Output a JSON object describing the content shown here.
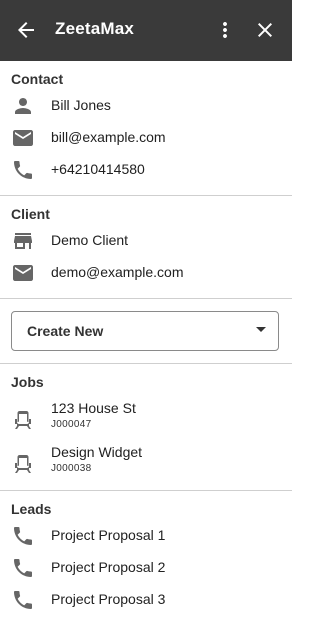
{
  "appbar": {
    "title": "ZeetaMax",
    "back_icon": "arrow-back-icon",
    "more_icon": "more-vert-icon",
    "close_icon": "close-icon",
    "background": "#3a3a3a"
  },
  "contact": {
    "heading": "Contact",
    "name": "Bill Jones",
    "email": "bill@example.com",
    "phone": "+64210414580"
  },
  "client": {
    "heading": "Client",
    "name": "Demo Client",
    "email": "demo@example.com"
  },
  "create_select": {
    "value": "Create New"
  },
  "jobs": {
    "heading": "Jobs",
    "items": [
      {
        "title": "123 House St",
        "code": "J000047"
      },
      {
        "title": "Design Widget",
        "code": "J000038"
      }
    ]
  },
  "leads": {
    "heading": "Leads",
    "items": [
      {
        "title": "Project Proposal 1"
      },
      {
        "title": "Project Proposal 2"
      },
      {
        "title": "Project Proposal 3"
      }
    ]
  }
}
